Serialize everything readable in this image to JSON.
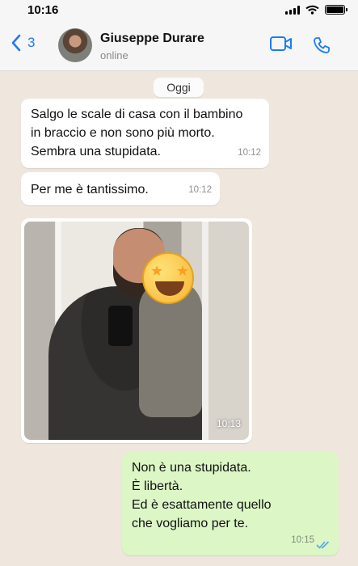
{
  "status_bar": {
    "time": "10:16",
    "signal_icon": "signal-icon",
    "wifi_icon": "wifi-icon",
    "battery_icon": "battery-icon",
    "battery_level": 1.0
  },
  "header": {
    "back_count": "3",
    "contact_name": "Giuseppe Durare",
    "contact_status": "online",
    "back_icon": "chevron-left-icon",
    "video_icon": "video-icon",
    "call_icon": "phone-icon",
    "accent_color": "#1d7bf6"
  },
  "chat": {
    "date_label": "Oggi",
    "messages": [
      {
        "direction": "incoming",
        "text": "Salgo le scale di casa con il bambino\nin braccio e non sono più morto.\nSembra una stupidata.",
        "time": "10:12"
      },
      {
        "direction": "incoming",
        "text": "Per me è tantissimo.",
        "time": "10:12"
      },
      {
        "direction": "incoming",
        "type": "photo",
        "time": "10:13",
        "overlay_icon": "star-struck-emoji"
      },
      {
        "direction": "outgoing",
        "text": "Non è una stupidata.\nÈ libertà.\nEd è esattamente quello\nche vogliamo per te.",
        "time": "10:15",
        "status_icon": "double-check-icon"
      }
    ],
    "incoming_bubble_color": "#ffffff",
    "outgoing_bubble_color": "#dcf6c6",
    "background_color": "#efe7de"
  }
}
